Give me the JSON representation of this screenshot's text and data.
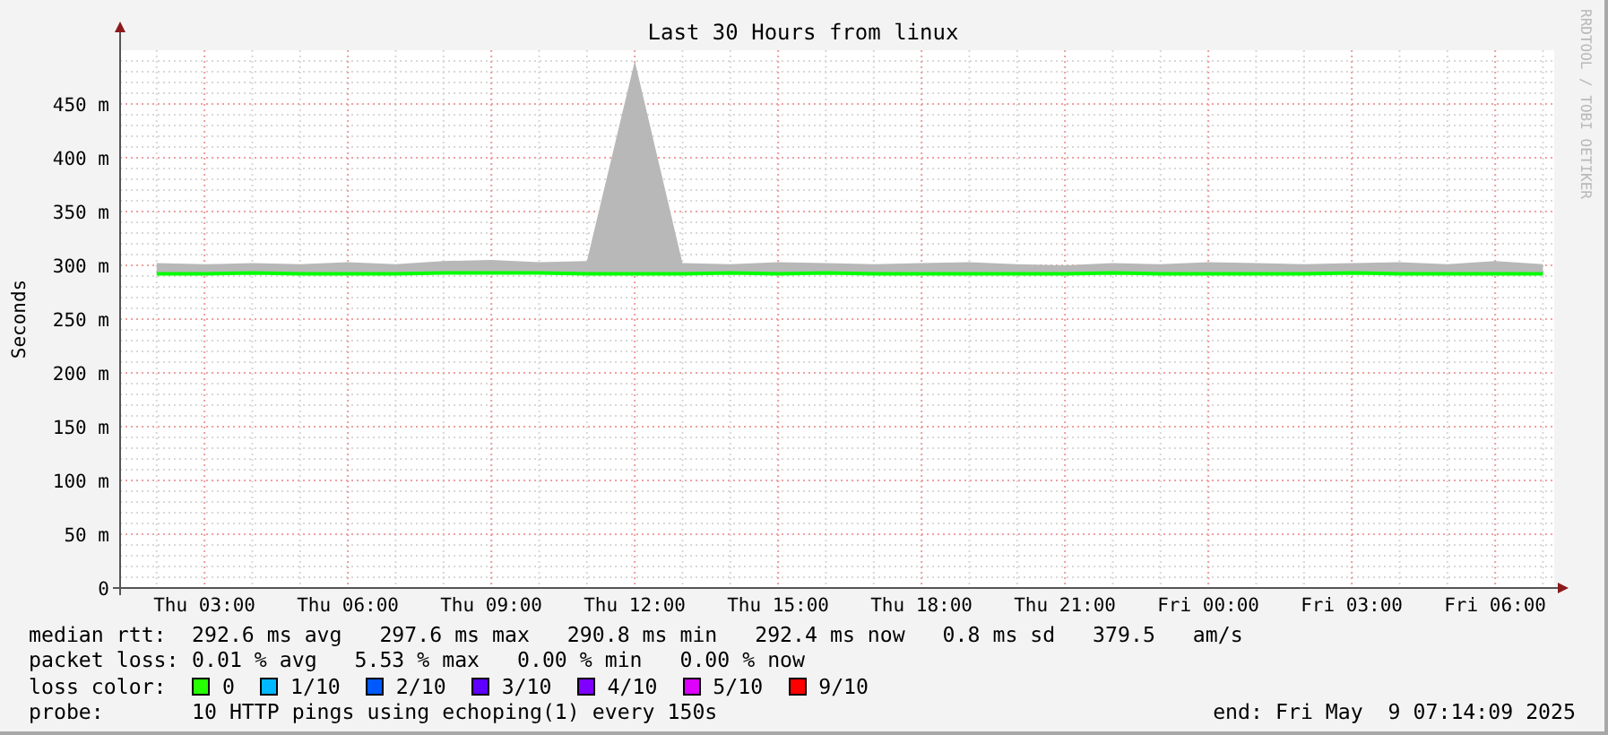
{
  "graph": {
    "watermark": "RRDTOOL / TOBI OETIKER",
    "chart_data": {
      "type": "line",
      "title": "Last 30 Hours from linux",
      "ylabel": "Seconds",
      "categories": [
        null,
        "Thu 03:00",
        null,
        null,
        "Thu 06:00",
        null,
        null,
        "Thu 09:00",
        null,
        null,
        "Thu 12:00",
        null,
        null,
        "Thu 15:00",
        null,
        null,
        "Thu 18:00",
        null,
        null,
        "Thu 21:00",
        null,
        null,
        "Fri 00:00",
        null,
        null,
        "Fri 03:00",
        null,
        null,
        "Fri 06:00",
        null
      ],
      "series": [
        {
          "type": "line",
          "color": "#00ff00",
          "values": [
            292,
            292,
            293,
            292,
            292,
            292,
            293,
            293,
            293,
            292,
            292,
            292,
            293,
            292,
            293,
            292,
            292,
            292,
            292,
            292,
            293,
            292,
            292,
            292,
            292,
            293,
            292,
            292,
            292,
            292
          ]
        },
        {
          "type": "area",
          "color": "#b8b8b8",
          "values": [
            302,
            301,
            302,
            301,
            303,
            301,
            304,
            305,
            303,
            304,
            490,
            302,
            301,
            303,
            302,
            301,
            302,
            303,
            301,
            300,
            302,
            301,
            303,
            302,
            301,
            302,
            303,
            301,
            304,
            301
          ]
        }
      ],
      "grid": true,
      "ylim": [
        0,
        490
      ],
      "yticks": [
        {
          "value": 0,
          "label": "0"
        },
        {
          "value": 50,
          "label": "50 m"
        },
        {
          "value": 100,
          "label": "100 m"
        },
        {
          "value": 150,
          "label": "150 m"
        },
        {
          "value": 200,
          "label": "200 m"
        },
        {
          "value": 250,
          "label": "250 m"
        },
        {
          "value": 300,
          "label": "300 m"
        },
        {
          "value": 350,
          "label": "350 m"
        },
        {
          "value": 400,
          "label": "400 m"
        },
        {
          "value": 450,
          "label": "450 m"
        }
      ]
    }
  },
  "legend": {
    "median_rtt": {
      "label": "median rtt:",
      "text": "292.6 ms avg   297.6 ms max   290.8 ms min   292.4 ms now   0.8 ms sd   379.5   am/s"
    },
    "packet_loss": {
      "label": "packet loss:",
      "text": "0.01 % avg   5.53 % max   0.00 % min   0.00 % now"
    },
    "loss_color": {
      "label": "loss color:",
      "items": [
        {
          "label": "0",
          "color": "#26ff00"
        },
        {
          "label": "1/10",
          "color": "#00b8ff"
        },
        {
          "label": "2/10",
          "color": "#0059ff"
        },
        {
          "label": "3/10",
          "color": "#5e00ff"
        },
        {
          "label": "4/10",
          "color": "#7e00ff"
        },
        {
          "label": "5/10",
          "color": "#dd00ff"
        },
        {
          "label": "9/10",
          "color": "#ff0000"
        }
      ]
    },
    "probe": {
      "label": "probe:",
      "text": "10 HTTP pings using echoping(1) every 150s"
    },
    "end": "end: Fri May  9 07:14:09 2025"
  }
}
